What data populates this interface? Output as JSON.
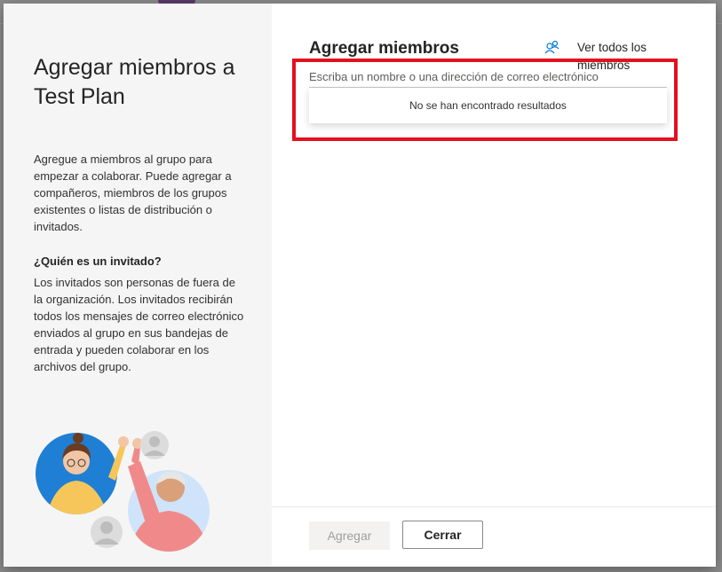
{
  "dialog": {
    "left": {
      "title": "Agregar miembros a Test Plan",
      "description": "Agregue a miembros al grupo para empezar a colaborar. Puede agregar a compañeros, miembros de los grupos existentes o listas de distribución o invitados.",
      "guest_heading": "¿Quién es un invitado?",
      "guest_description": "Los invitados son personas de fuera de la organización. Los invitados recibirán todos los mensajes de correo electrónico enviados al grupo en sus bandejas de entrada y pueden colaborar en los archivos del grupo.",
      "illustration_icon": "people-collaboration-illustration"
    },
    "right": {
      "title": "Agregar miembros",
      "view_all_label": "Ver todos los miembros",
      "view_all_icon": "people-icon",
      "search_placeholder": "Escriba un nombre o una dirección de correo electrónico",
      "no_results": "No se han encontrado resultados"
    },
    "footer": {
      "add_label": "Agregar",
      "close_label": "Cerrar"
    }
  },
  "colors": {
    "highlight": "#e3101f",
    "accent": "#0078d4",
    "left_panel_bg": "#f5f5f5"
  }
}
